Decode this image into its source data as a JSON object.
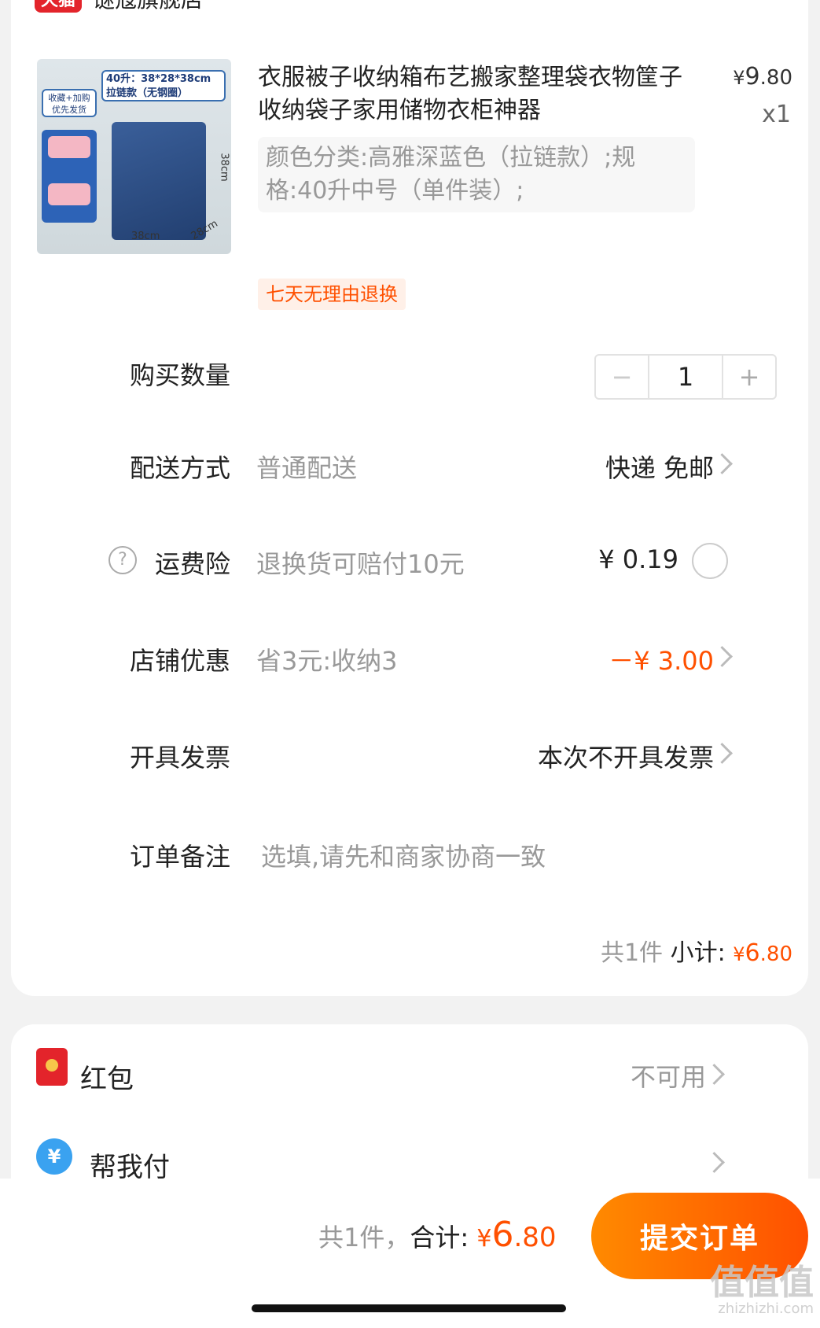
{
  "store": {
    "badge": "天猫",
    "name": "谜寇旗舰店"
  },
  "product": {
    "image_text": {
      "tag1": "40升：38*28*38cm 拉链款（无钢圈）",
      "tag2": "收藏+加购 优先发货",
      "dim_width": "38cm",
      "dim_depth": "28cm",
      "dim_height": "38cm"
    },
    "title": "衣服被子收纳箱布艺搬家整理袋衣物筐子收纳袋子家用储物衣柜神器",
    "price_currency": "¥",
    "price_int": "9",
    "price_dec": ".80",
    "quantity": "x1",
    "sku": "颜色分类:高雅深蓝色（拉链款）;规格:40升中号（单件装）;",
    "return_tag": "七天无理由退换"
  },
  "rows": {
    "quantity_label": "购买数量",
    "stepper": {
      "minus": "−",
      "value": "1",
      "plus": "+"
    },
    "delivery_label": "配送方式",
    "delivery_sub": "普通配送",
    "delivery_value": "快递 免邮",
    "insurance_help": "?",
    "insurance_label": "运费险",
    "insurance_sub": "退换货可赔付10元",
    "insurance_value": "¥ 0.19",
    "discount_label": "店铺优惠",
    "discount_sub": "省3元:收纳3",
    "discount_value": "－¥ 3.00",
    "invoice_label": "开具发票",
    "invoice_value": "本次不开具发票",
    "note_label": "订单备注",
    "note_placeholder": "选填,请先和商家协商一致"
  },
  "subtotal": {
    "count": "共1件",
    "label": "小计:",
    "currency": "¥",
    "int": "6",
    "dec": ".80"
  },
  "extras": {
    "redpacket_label": "红包",
    "redpacket_value": "不可用",
    "pay_icon": "¥",
    "pay_label": "帮我付"
  },
  "footer": {
    "count": "共1件，",
    "label": "合计:",
    "currency": "¥",
    "int": "6",
    "dec": ".80",
    "submit": "提交订单"
  },
  "watermark": {
    "line1": "值值值",
    "line2": "zhizhizhi.com"
  },
  "colors": {
    "accent": "#ff5000",
    "tmall_red": "#e3242b"
  }
}
